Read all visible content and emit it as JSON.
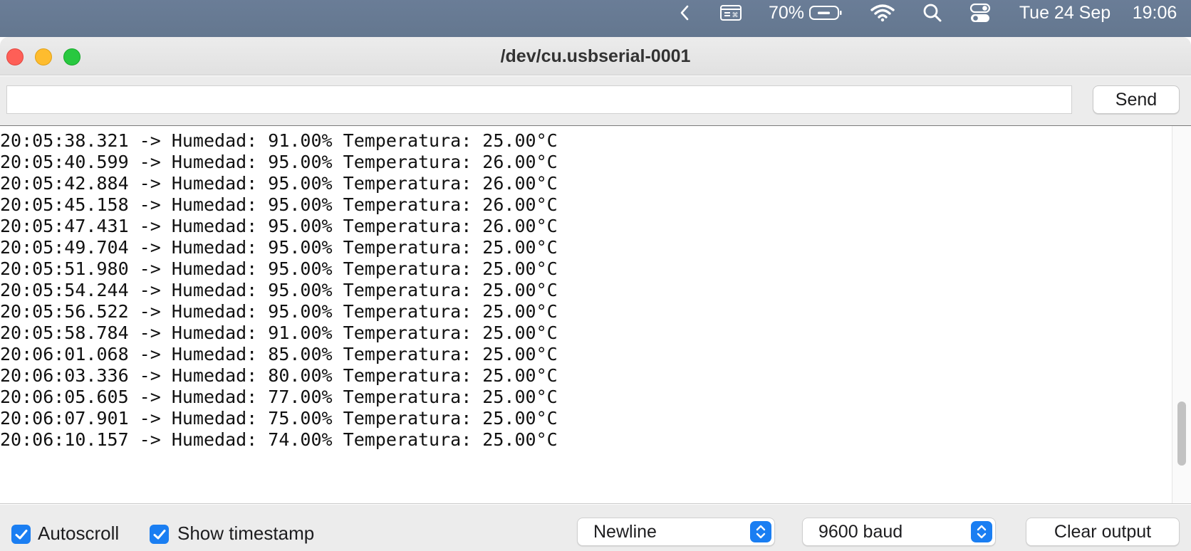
{
  "menubar": {
    "battery_percent": "70%",
    "date": "Tue 24 Sep",
    "time": "19:06",
    "icons": [
      "chevron-left-icon",
      "keyboard-shortcuts-icon",
      "battery-icon",
      "wifi-icon",
      "spotlight-search-icon",
      "control-center-icon"
    ]
  },
  "window": {
    "title": "/dev/cu.usbserial-0001"
  },
  "input": {
    "value": "",
    "placeholder": "",
    "send_label": "Send"
  },
  "output": {
    "lines": [
      "20:05:38.321 -> Humedad: 91.00% Temperatura: 25.00°C",
      "20:05:40.599 -> Humedad: 95.00% Temperatura: 26.00°C",
      "20:05:42.884 -> Humedad: 95.00% Temperatura: 26.00°C",
      "20:05:45.158 -> Humedad: 95.00% Temperatura: 26.00°C",
      "20:05:47.431 -> Humedad: 95.00% Temperatura: 26.00°C",
      "20:05:49.704 -> Humedad: 95.00% Temperatura: 25.00°C",
      "20:05:51.980 -> Humedad: 95.00% Temperatura: 25.00°C",
      "20:05:54.244 -> Humedad: 95.00% Temperatura: 25.00°C",
      "20:05:56.522 -> Humedad: 95.00% Temperatura: 25.00°C",
      "20:05:58.784 -> Humedad: 91.00% Temperatura: 25.00°C",
      "20:06:01.068 -> Humedad: 85.00% Temperatura: 25.00°C",
      "20:06:03.336 -> Humedad: 80.00% Temperatura: 25.00°C",
      "20:06:05.605 -> Humedad: 77.00% Temperatura: 25.00°C",
      "20:06:07.901 -> Humedad: 75.00% Temperatura: 25.00°C",
      "20:06:10.157 -> Humedad: 74.00% Temperatura: 25.00°C"
    ],
    "scroll_position": 0.88,
    "scroll_visible_fraction": 0.17
  },
  "footer": {
    "autoscroll_label": "Autoscroll",
    "autoscroll_checked": true,
    "timestamp_label": "Show timestamp",
    "timestamp_checked": true,
    "line_ending": "Newline",
    "baud_rate": "9600 baud",
    "clear_label": "Clear output"
  },
  "colors": {
    "accent": "#1a7ef2",
    "menubar": "#667a93",
    "close": "#fe5f57",
    "minimize": "#febc2e",
    "maximize": "#28c840"
  }
}
